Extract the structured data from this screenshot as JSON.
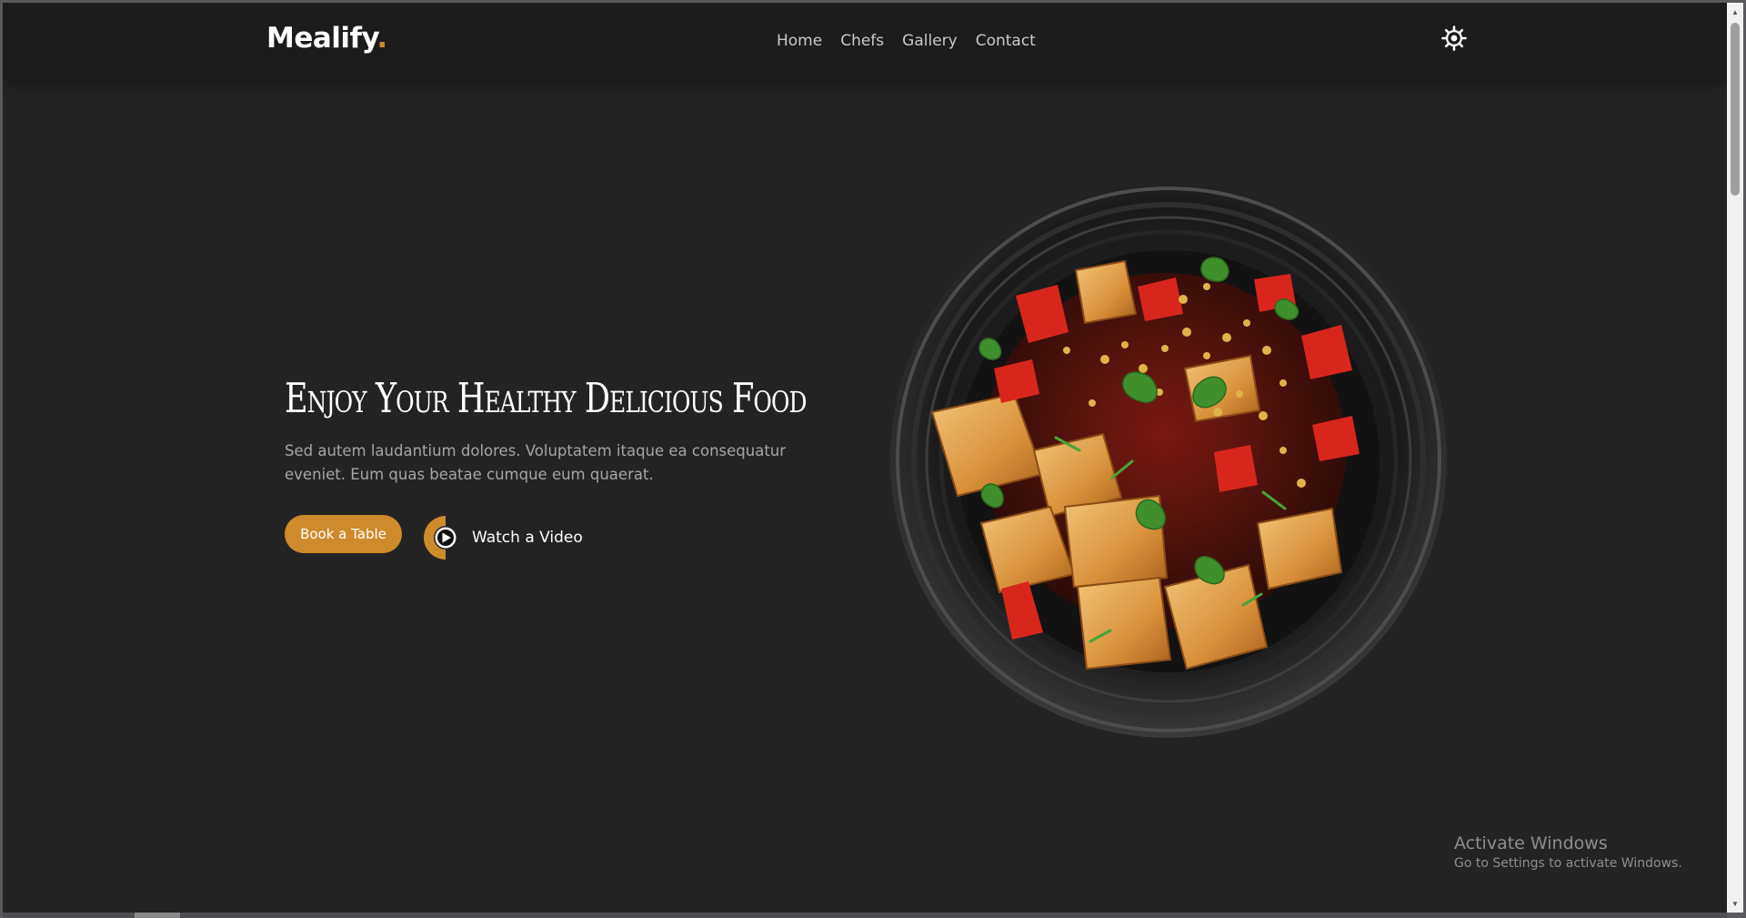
{
  "brand": {
    "name": "Mealify",
    "dot": ".",
    "accent_color": "#cd8d2a"
  },
  "nav": {
    "items": [
      {
        "label": "Home"
      },
      {
        "label": "Chefs"
      },
      {
        "label": "Gallery"
      },
      {
        "label": "Contact"
      }
    ]
  },
  "header": {
    "settings_icon": "gear-icon"
  },
  "hero": {
    "title": "Enjoy Your Healthy Delicious Food",
    "description": "Sed autem laudantium dolores. Voluptatem itaque ea consequatur eveniet. Eum quas beatae cumque eum quaerat.",
    "book_button": "Book a Table",
    "video_button": "Watch a Video",
    "video_icon": "play-icon",
    "image": "plate-of-food-image"
  },
  "watermark": {
    "title": "Activate Windows",
    "subtitle": "Go to Settings to activate Windows."
  },
  "colors": {
    "background": "#232323",
    "header": "#1c1c1c",
    "button": "#cd8b2b"
  }
}
